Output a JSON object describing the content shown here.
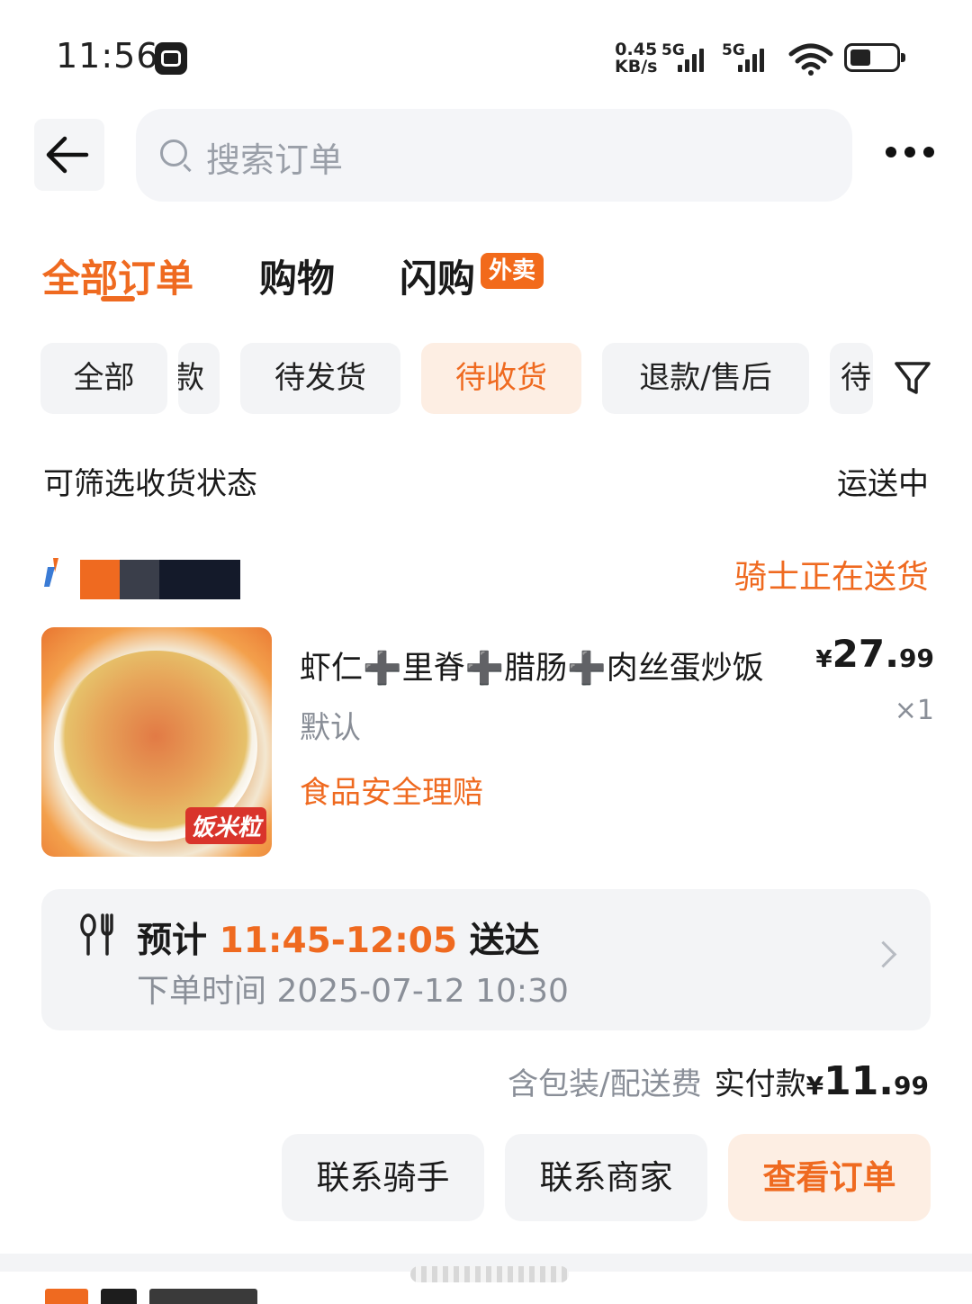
{
  "status_bar": {
    "time": "11:56",
    "net_speed_value": "0.45",
    "net_speed_unit": "KB/s",
    "sim1_type": "5G",
    "sim2_type": "5G",
    "battery_level": 0.4
  },
  "header": {
    "search_placeholder": "搜索订单"
  },
  "tabs": [
    {
      "label": "全部订单",
      "active": true
    },
    {
      "label": "购物",
      "active": false
    },
    {
      "label": "闪购",
      "active": false,
      "badge": "外卖"
    }
  ],
  "chips": [
    {
      "label": "全部",
      "active": false
    },
    {
      "label": "款",
      "active": false
    },
    {
      "label": "待发货",
      "active": false
    },
    {
      "label": "待收货",
      "active": true
    },
    {
      "label": "退款/售后",
      "active": false
    },
    {
      "label": "待",
      "active": false
    }
  ],
  "filter_row": {
    "label": "可筛选收货状态",
    "value": "运送中"
  },
  "order": {
    "status": "骑士正在送货",
    "image_tag": "饭米粒",
    "item_name": "虾仁➕里脊➕腊肠➕肉丝蛋炒饭",
    "item_spec": "默认",
    "guarantee": "食品安全理赔",
    "price_currency": "¥",
    "price_int": "27.",
    "price_dec": "99",
    "quantity": "×1",
    "eta_prefix": "预计",
    "eta_time": "11:45-12:05",
    "eta_suffix": "送达",
    "placed_label": "下单时间",
    "placed_time": "2025-07-12 10:30",
    "fee_note": "含包装/配送费",
    "paid_label": "实付款",
    "paid_currency": "¥",
    "paid_int": "11.",
    "paid_dec": "99",
    "buttons": {
      "contact_rider": "联系骑手",
      "contact_merchant": "联系商家",
      "view_order": "查看订单"
    }
  },
  "colors": {
    "accent": "#ef6a20",
    "chip_bg": "#f3f4f6",
    "accent_bg": "#fdeee3"
  }
}
